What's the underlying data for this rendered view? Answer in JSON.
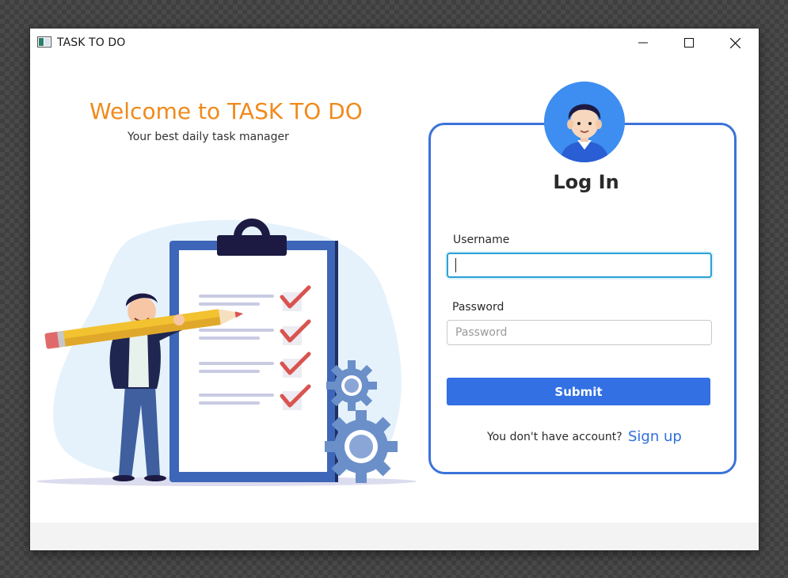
{
  "window": {
    "title": "TASK TO DO",
    "controls": {
      "minimize_icon": "minimize-icon",
      "maximize_icon": "maximize-icon",
      "close_icon": "close-icon"
    }
  },
  "welcome": {
    "title": "Welcome to TASK TO DO",
    "subtitle": "Your best daily task manager"
  },
  "login": {
    "heading": "Log In",
    "username": {
      "label": "Username",
      "value": "",
      "placeholder": ""
    },
    "password": {
      "label": "Password",
      "value": "",
      "placeholder": "Password"
    },
    "submit_label": "Submit",
    "no_account_text": "You don't have account?",
    "signup_label": "Sign up"
  },
  "colors": {
    "accent": "#3270e3",
    "card_border": "#3b73d9",
    "welcome_title": "#f08a1c",
    "link": "#2f6fdc"
  }
}
